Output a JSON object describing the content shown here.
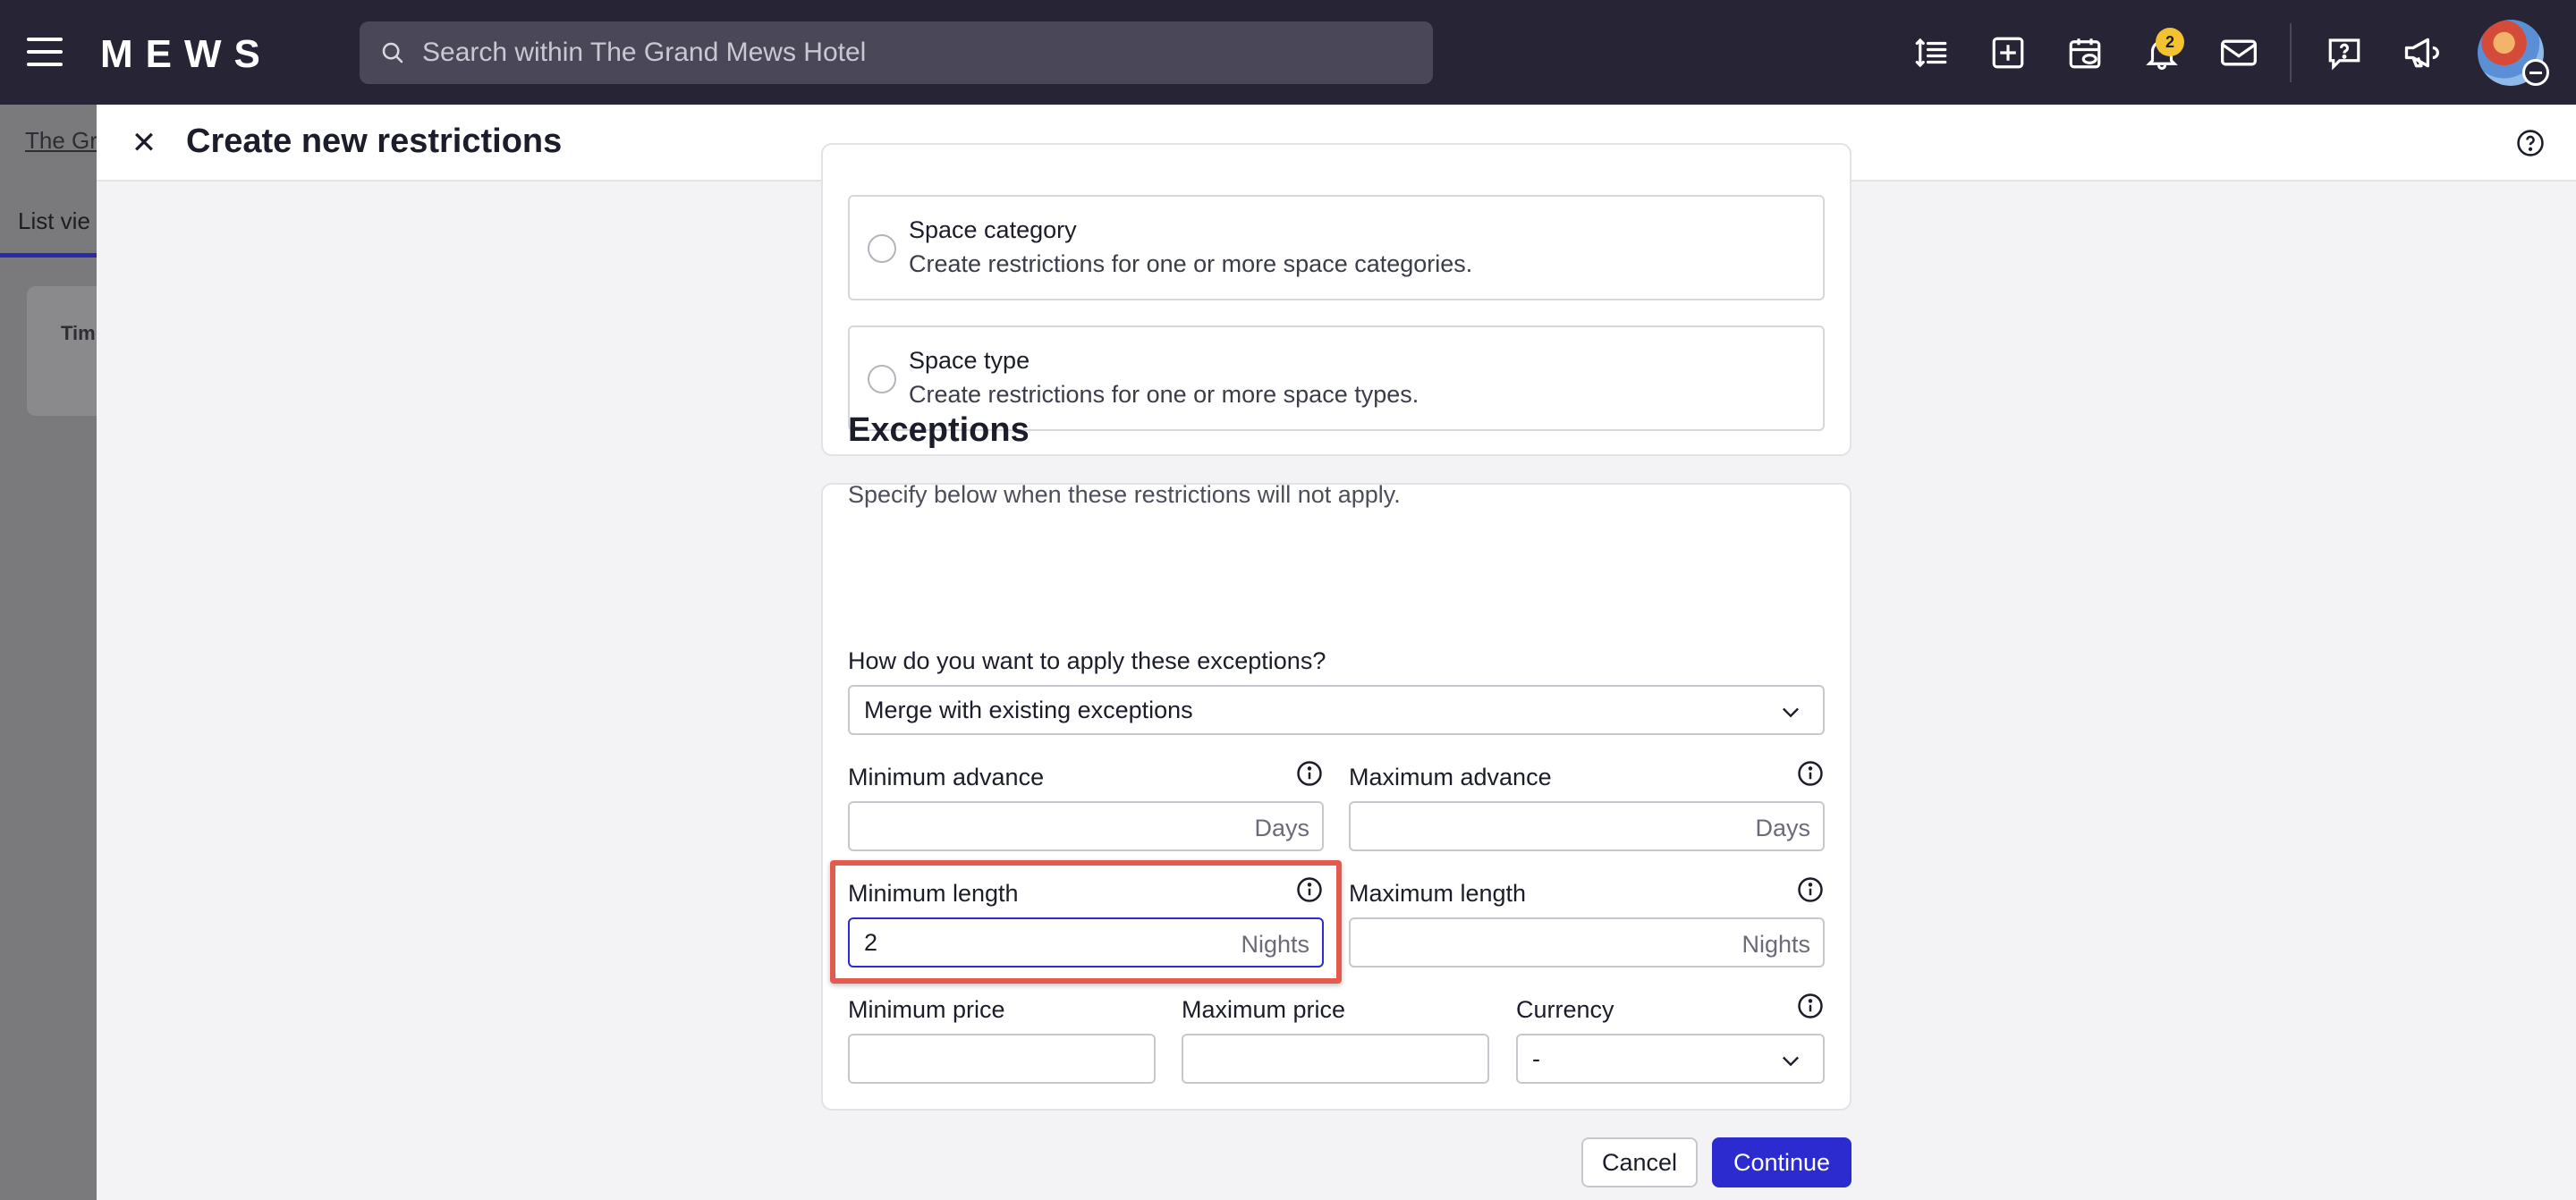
{
  "topbar": {
    "logo": "MEWS",
    "search_placeholder": "Search within The Grand Mews Hotel",
    "notification_count": "2"
  },
  "background": {
    "breadcrumb": "The Gr",
    "tab": "List vie",
    "card_label": "Tim"
  },
  "dialog": {
    "title": "Create new restrictions",
    "options": [
      {
        "title": "Space category",
        "desc": "Create restrictions for one or more space categories."
      },
      {
        "title": "Space type",
        "desc": "Create restrictions for one or more space types."
      }
    ],
    "exceptions": {
      "title": "Exceptions",
      "desc": "Specify below when these restrictions will not apply.",
      "apply_label": "How do you want to apply these exceptions?",
      "apply_value": "Merge with existing exceptions",
      "min_advance_label": "Minimum advance",
      "max_advance_label": "Maximum advance",
      "days_unit": "Days",
      "min_length_label": "Minimum length",
      "min_length_value": "2",
      "max_length_label": "Maximum length",
      "nights_unit": "Nights",
      "min_price_label": "Minimum price",
      "max_price_label": "Maximum price",
      "currency_label": "Currency",
      "currency_value": "-"
    },
    "buttons": {
      "cancel": "Cancel",
      "continue": "Continue"
    }
  },
  "colors": {
    "topbar": "#272535",
    "primary": "#2c2bd0",
    "highlight": "#e45a4f",
    "badge": "#f2c230"
  }
}
